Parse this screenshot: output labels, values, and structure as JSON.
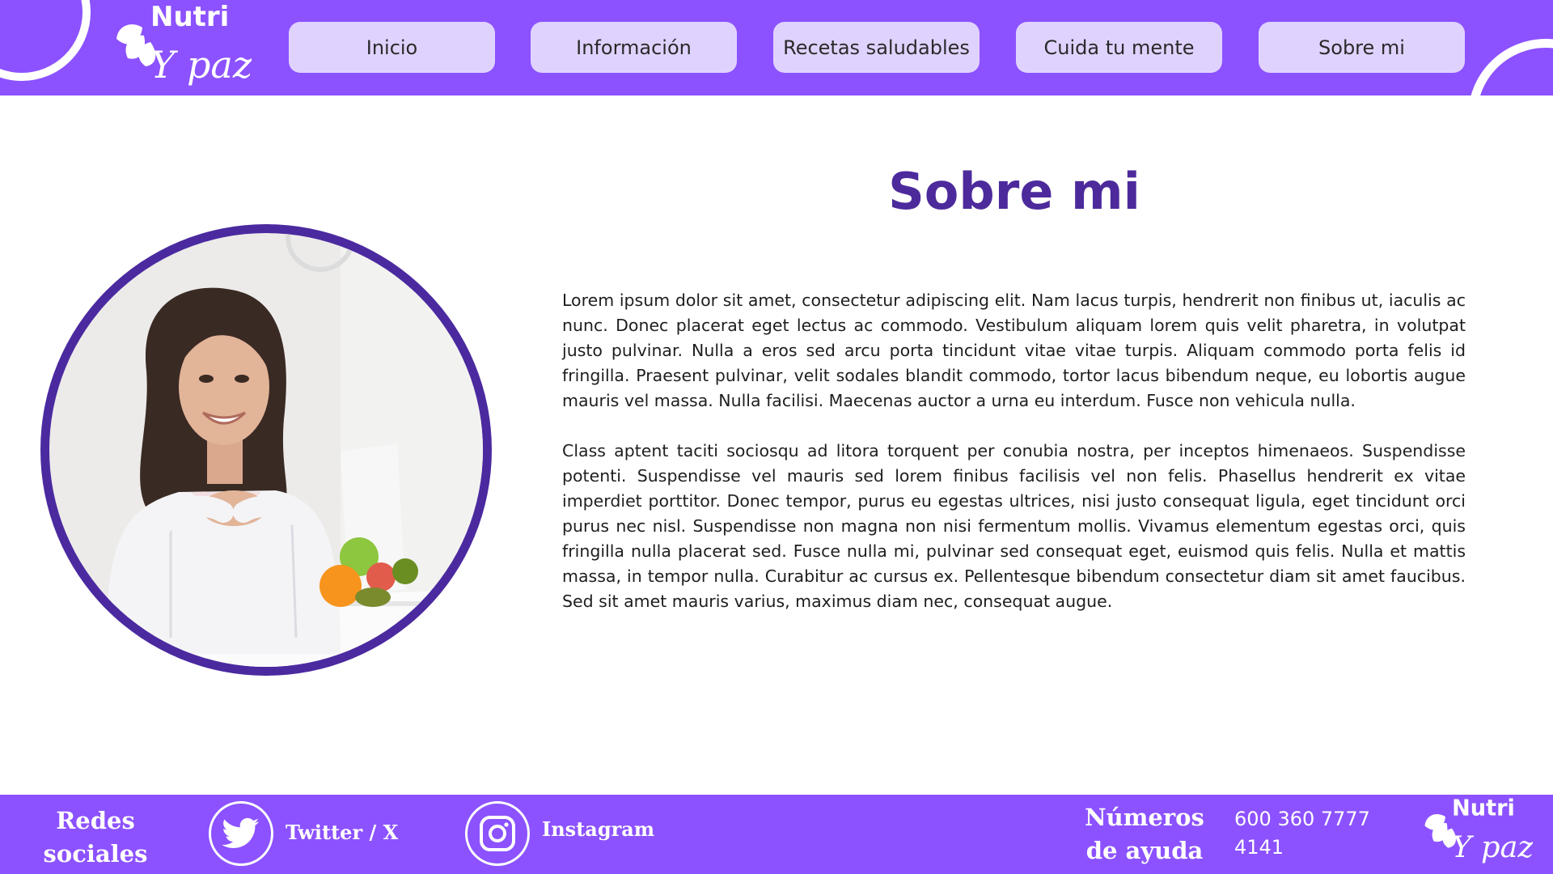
{
  "header": {
    "logo": {
      "line1": "Nutri",
      "line2": "Y paz"
    },
    "nav": [
      {
        "label": "Inicio"
      },
      {
        "label": "Información"
      },
      {
        "label": "Recetas saludables"
      },
      {
        "label": "Cuida tu mente"
      },
      {
        "label": "Sobre mi"
      }
    ]
  },
  "main": {
    "title": "Sobre mi",
    "photo_icon": "nutritionist-portrait",
    "paragraphs": [
      "Lorem ipsum dolor sit amet, consectetur adipiscing elit. Nam lacus turpis, hendrerit non finibus ut, iaculis ac nunc. Donec placerat eget lectus ac commodo. Vestibulum aliquam lorem quis velit pharetra, in volutpat justo pulvinar. Nulla a eros sed arcu porta tincidunt vitae vitae turpis. Aliquam commodo porta felis id fringilla. Praesent pulvinar, velit sodales blandit commodo, tortor lacus bibendum neque, eu lobortis augue mauris vel massa. Nulla facilisi. Maecenas auctor a urna eu interdum. Fusce non vehicula nulla.",
      "Class aptent taciti sociosqu ad litora torquent per conubia nostra, per inceptos himenaeos. Suspendisse potenti. Suspendisse vel mauris sed lorem finibus facilisis vel non felis. Phasellus hendrerit ex vitae imperdiet porttitor. Donec tempor, purus eu egestas ultrices, nisi justo consequat ligula, eget tincidunt orci purus nec nisl. Suspendisse non magna non nisi fermentum mollis. Vivamus elementum egestas orci, quis fringilla nulla placerat sed. Fusce nulla mi, pulvinar sed consequat eget, euismod quis felis. Nulla et mattis massa, in tempor nulla. Curabitur ac cursus ex. Pellentesque bibendum consectetur diam sit amet faucibus. Sed sit amet mauris varius, maximus diam nec, consequat augue."
    ]
  },
  "footer": {
    "social_heading_line1": "Redes",
    "social_heading_line2": "sociales",
    "twitter": {
      "label": "Twitter / X",
      "icon": "twitter-bird-icon"
    },
    "instagram": {
      "label": "Instagram",
      "icon": "instagram-icon"
    },
    "help_heading_line1": "Números",
    "help_heading_line2": "de ayuda",
    "phones": [
      "600 360 7777",
      "4141"
    ],
    "logo": {
      "line1": "Nutri",
      "line2": "Y paz"
    }
  },
  "colors": {
    "brand_purple": "#8c52ff",
    "nav_button": "#e0d2ff",
    "title_purple": "#4d2a9c",
    "photo_ring": "#4b2aa0"
  }
}
